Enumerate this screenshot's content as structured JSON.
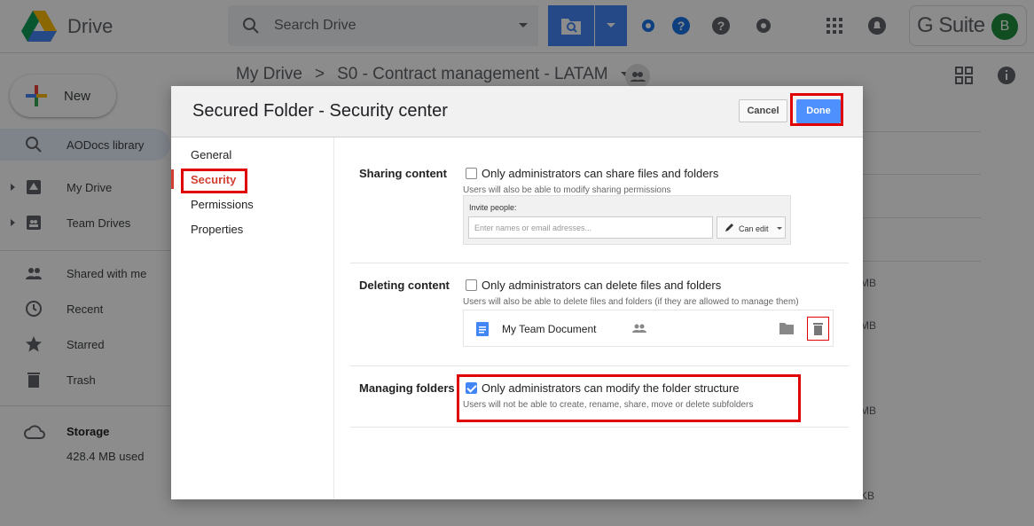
{
  "app": {
    "brand": "Drive",
    "search_placeholder": "Search Drive",
    "gsuite_label": "G Suite",
    "avatar_initial": "B"
  },
  "breadcrumb": {
    "root": "My Drive",
    "separator": ">",
    "current": "S0 - Contract management - LATAM"
  },
  "sidebar": {
    "new_label": "New",
    "items": [
      {
        "label": "AODocs library",
        "icon": "search-icon"
      },
      {
        "label": "My Drive",
        "icon": "drive-icon"
      },
      {
        "label": "Team Drives",
        "icon": "team-drive-icon"
      },
      {
        "label": "Shared with me",
        "icon": "people-icon"
      },
      {
        "label": "Recent",
        "icon": "clock-icon"
      },
      {
        "label": "Starred",
        "icon": "star-icon"
      },
      {
        "label": "Trash",
        "icon": "trash-icon"
      }
    ],
    "storage_label": "Storage",
    "storage_used": "428.4 MB used"
  },
  "background_sizes": [
    "MB",
    "MB",
    "MB",
    "KB"
  ],
  "dialog": {
    "title": "Secured Folder - Security center",
    "cancel_label": "Cancel",
    "done_label": "Done",
    "nav": [
      "General",
      "Security",
      "Permissions",
      "Properties"
    ],
    "selected_nav": "Security",
    "sections": {
      "sharing": {
        "label": "Sharing content",
        "option": "Only administrators can share files and folders",
        "checked": false,
        "note": "Users will also be able to modify sharing permissions",
        "invite_label": "Invite people:",
        "invite_placeholder": "Enter names or email adresses...",
        "permission": "Can edit"
      },
      "deleting": {
        "label": "Deleting content",
        "option": "Only administrators can delete files and folders",
        "checked": false,
        "note": "Users will also be able to delete files and folders (if they are allowed to manage them)",
        "doc_name": "My Team Document"
      },
      "managing": {
        "label": "Managing folders",
        "option": "Only administrators can modify the folder structure",
        "checked": true,
        "note": "Users will not be able to create, rename, share, move or delete subfolders"
      }
    }
  },
  "colors": {
    "accent": "#4285f4",
    "done_button": "#4d90fe",
    "highlight": "#e00000",
    "selected_nav": "#d23f31"
  }
}
